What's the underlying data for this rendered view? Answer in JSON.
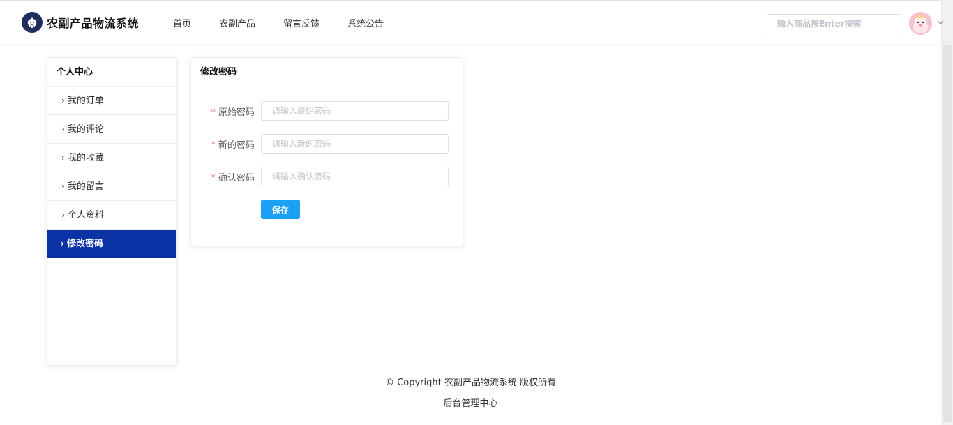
{
  "header": {
    "app_title": "农副产品物流系统",
    "nav": [
      "首页",
      "农副产品",
      "留言反馈",
      "系统公告"
    ],
    "search_placeholder": "输入商品按Enter搜索",
    "logo_icon": "strawberry-icon",
    "avatar_icon": "user-avatar",
    "chevron_icon": "chevron-down-icon"
  },
  "sidebar": {
    "title": "个人中心",
    "items": [
      {
        "label": "我的订单",
        "active": false
      },
      {
        "label": "我的评论",
        "active": false
      },
      {
        "label": "我的收藏",
        "active": false
      },
      {
        "label": "我的留言",
        "active": false
      },
      {
        "label": "个人资料",
        "active": false
      },
      {
        "label": "修改密码",
        "active": true
      }
    ]
  },
  "form": {
    "title": "修改密码",
    "required_mark": "*",
    "fields": [
      {
        "label": "原始密码",
        "placeholder": "请输入原始密码",
        "value": ""
      },
      {
        "label": "新的密码",
        "placeholder": "请输入新的密码",
        "value": ""
      },
      {
        "label": "确认密码",
        "placeholder": "请输入确认密码",
        "value": ""
      }
    ],
    "save_label": "保存"
  },
  "footer": {
    "copyright": "© Copyright 农副产品物流系统 版权所有",
    "admin_link": "后台管理中心"
  },
  "colors": {
    "accent": "#0b33a5",
    "button": "#1aa0f5",
    "required": "#f56c6c"
  }
}
